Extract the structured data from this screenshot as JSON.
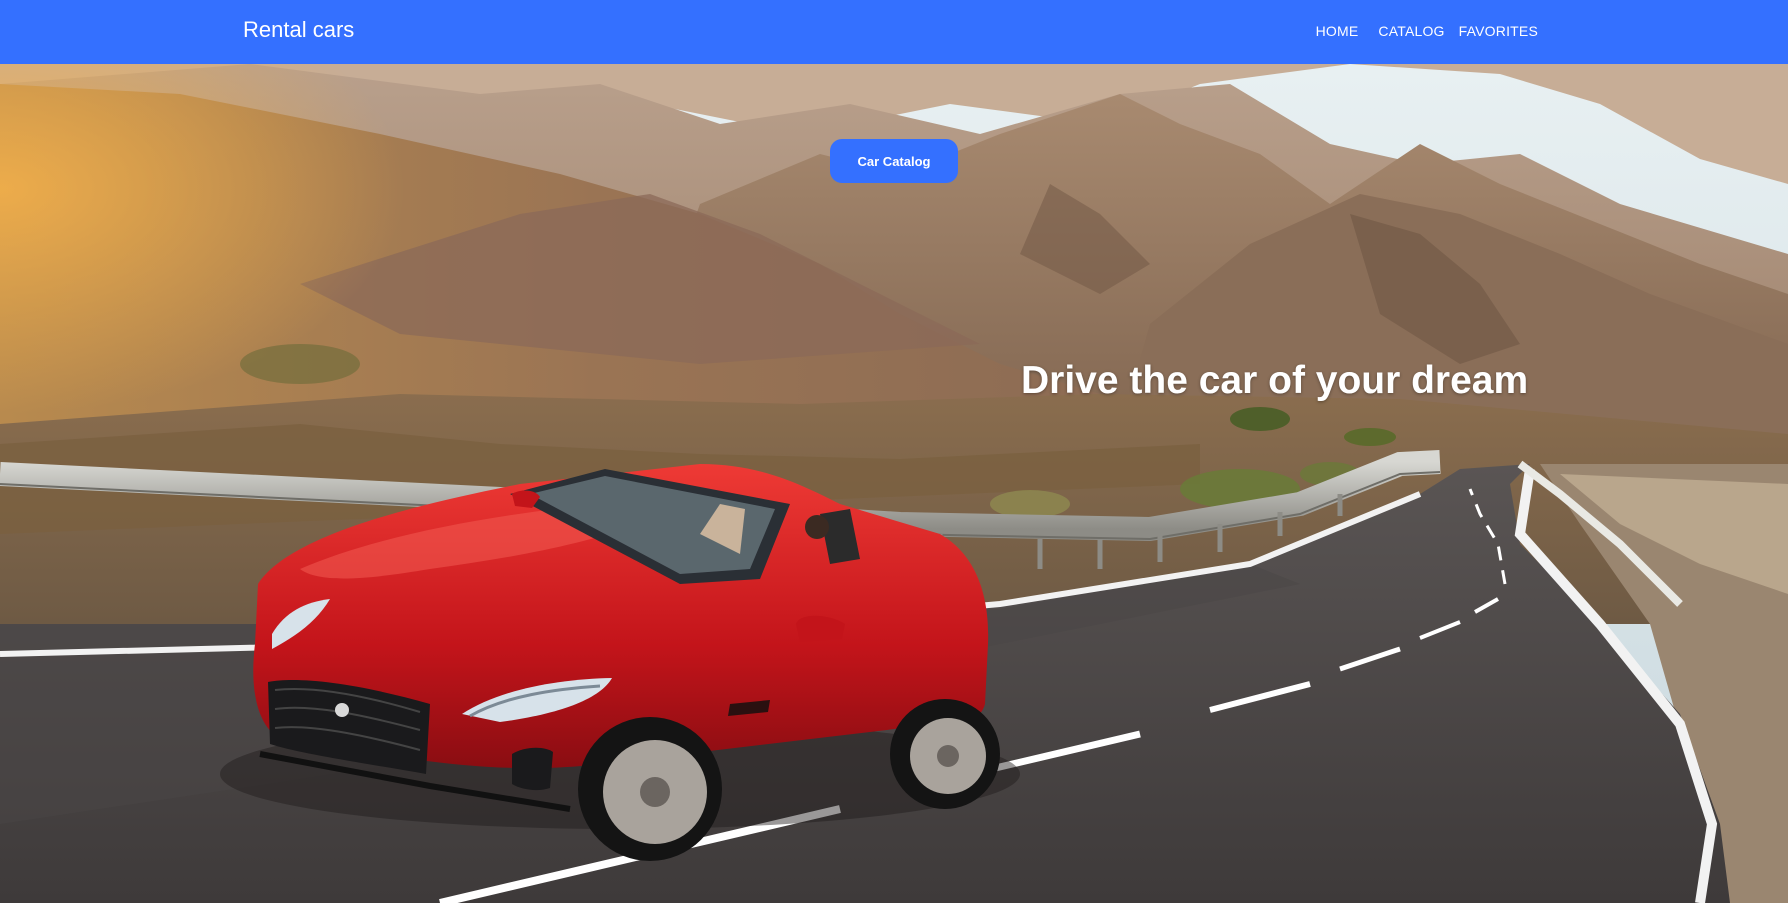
{
  "header": {
    "brand": "Rental cars",
    "nav": [
      {
        "label": "HOME"
      },
      {
        "label": "CATALOG"
      },
      {
        "label": "FAVORITES"
      }
    ],
    "background_color": "#3470ff"
  },
  "hero": {
    "button_label": "Car Catalog",
    "headline": "Drive the car of your dream",
    "image": "red convertible sports car on a winding mountain road",
    "car_color": "#d11a1f"
  }
}
